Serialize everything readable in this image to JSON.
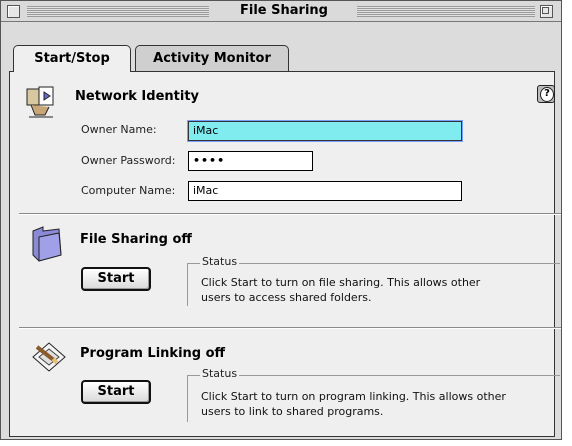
{
  "window": {
    "title": "File Sharing"
  },
  "tabs": [
    {
      "label": "Start/Stop",
      "active": true
    },
    {
      "label": "Activity Monitor",
      "active": false
    }
  ],
  "network_identity": {
    "title": "Network Identity",
    "owner_name_label": "Owner Name:",
    "owner_name_value": "iMac",
    "owner_password_label": "Owner Password:",
    "owner_password_value": "••••",
    "computer_name_label": "Computer Name:",
    "computer_name_value": "iMac",
    "help_icon": "question-mark-icon"
  },
  "file_sharing": {
    "title": "File Sharing off",
    "button_label": "Start",
    "status_label": "Status",
    "status_text_line1": "Click Start to turn on file sharing. This allows other",
    "status_text_line2": "users to access shared folders."
  },
  "program_linking": {
    "title": "Program Linking off",
    "button_label": "Start",
    "status_label": "Status",
    "status_text_line1": "Click Start to turn on program linking. This allows other",
    "status_text_line2": "users to link to shared programs."
  },
  "colors": {
    "focus_field": "#80ecf0",
    "window_bg": "#dcdcdc",
    "panel_bg": "#efefef"
  }
}
